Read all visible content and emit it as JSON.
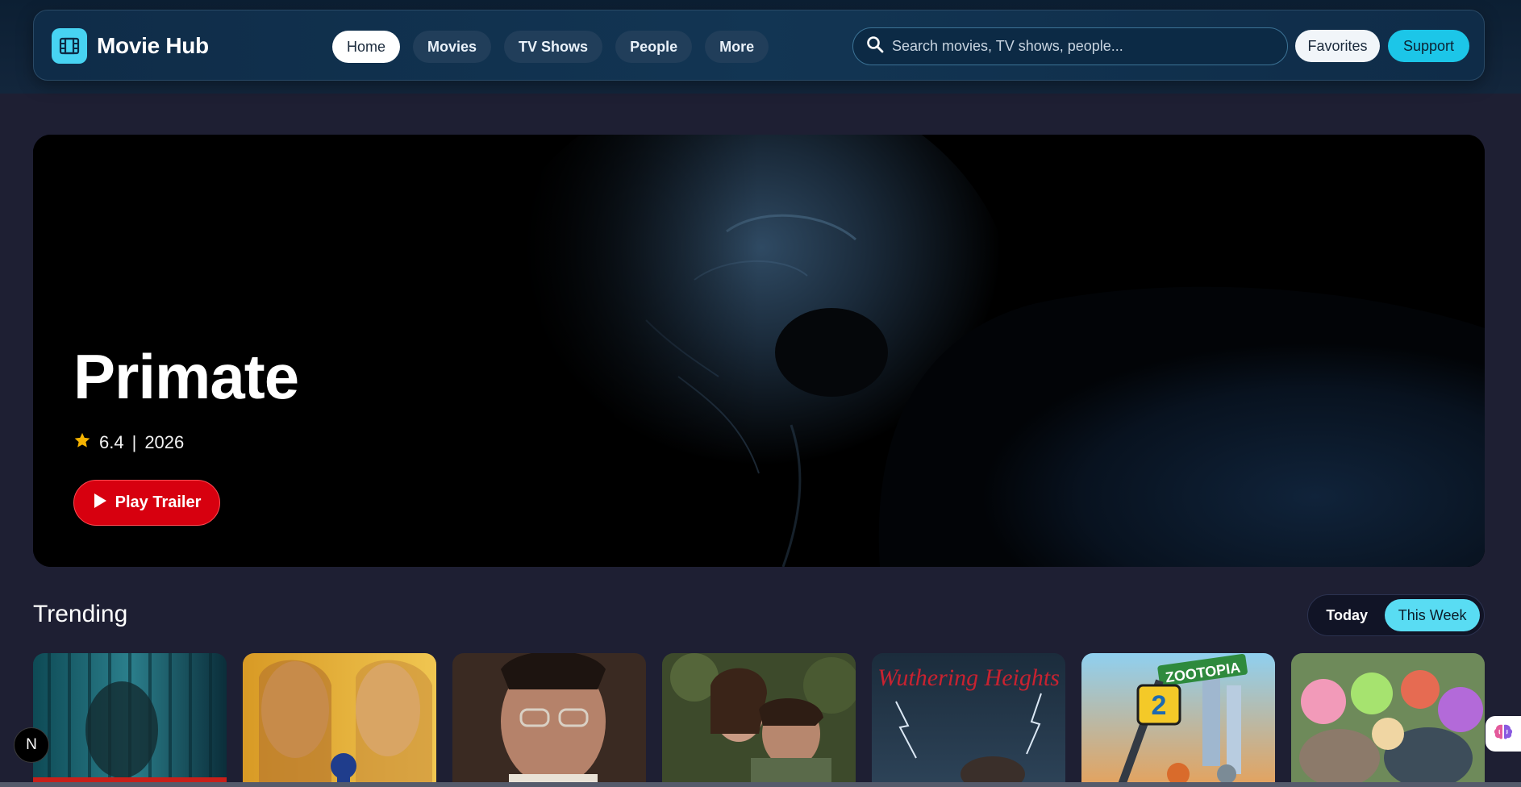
{
  "header": {
    "brand_name": "Movie Hub",
    "nav": [
      "Home",
      "Movies",
      "TV Shows",
      "People",
      "More"
    ],
    "search_placeholder": "Search movies, TV shows, people...",
    "favorites_label": "Favorites",
    "support_label": "Support"
  },
  "hero": {
    "title": "Primate",
    "rating": "6.4",
    "separator": "|",
    "year": "2026",
    "play_label": "Play Trailer"
  },
  "trending": {
    "title": "Trending",
    "toggle": {
      "today": "Today",
      "week": "This Week",
      "selected": "This Week"
    }
  },
  "posters": [
    {
      "text": ""
    },
    {
      "text": ""
    },
    {
      "text": ""
    },
    {
      "text": ""
    },
    {
      "text": "Wuthering Heights"
    },
    {
      "text": "ZOOTOPIA"
    },
    {
      "text": ""
    }
  ],
  "floating": {
    "n_badge": "N"
  },
  "colors": {
    "accent": "#47d3f2",
    "play": "#d7000f",
    "page_bg": "#1e1f33",
    "rating_star": "#f5b301"
  },
  "icons": {
    "brand": "film-icon",
    "search": "search-icon",
    "star": "star-icon",
    "play": "play-icon",
    "assistant": "brain-icon"
  }
}
